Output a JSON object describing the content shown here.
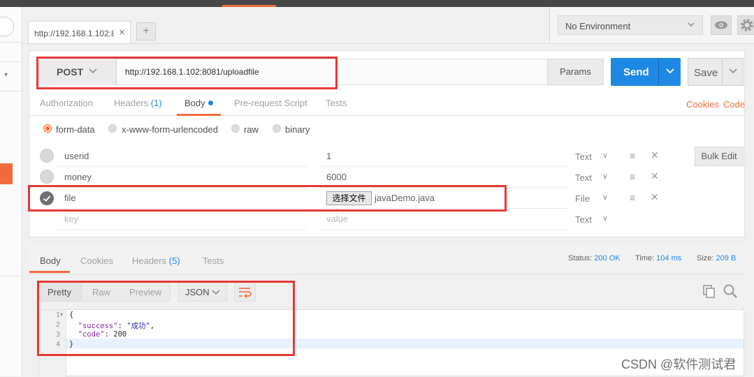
{
  "request_tab": {
    "label": "http://192.168.1.102:8",
    "close": "×",
    "new_tab": "+"
  },
  "environment": {
    "selected": "No Environment"
  },
  "request": {
    "method": "POST",
    "url": "http://192.168.1.102:8081/uploadfile",
    "params_label": "Params",
    "send_label": "Send",
    "save_label": "Save"
  },
  "request_tabs": {
    "authorization": "Authorization",
    "headers": "Headers",
    "headers_count": "(1)",
    "body": "Body",
    "prerequest": "Pre-request Script",
    "tests": "Tests",
    "cookies": "Cookies",
    "code": "Code"
  },
  "body_modes": [
    "form-data",
    "x-www-form-urlencoded",
    "raw",
    "binary"
  ],
  "form_rows": [
    {
      "key": "userid",
      "value": "1",
      "type": "Text"
    },
    {
      "key": "money",
      "value": "6000",
      "type": "Text"
    },
    {
      "key": "file",
      "file_button": "选择文件",
      "value": "javaDemo.java",
      "type": "File"
    }
  ],
  "form_placeholder": {
    "key": "key",
    "value": "value",
    "type": "Text"
  },
  "bulk_edit_label": "Bulk Edit",
  "response_tabs": {
    "body": "Body",
    "cookies": "Cookies",
    "headers": "Headers",
    "headers_count": "(5)",
    "tests": "Tests"
  },
  "response_status": {
    "status_label": "Status:",
    "status_value": "200 OK",
    "time_label": "Time:",
    "time_value": "104 ms",
    "size_label": "Size:",
    "size_value": "209 B"
  },
  "view_modes": [
    "Pretty",
    "Raw",
    "Preview"
  ],
  "format": "JSON",
  "code_lines": {
    "line_numbers": [
      "1",
      "2",
      "3",
      "4"
    ],
    "l1": "{",
    "l2_key": "\"success\"",
    "l2_value": "\"成功\"",
    "l3_key": "\"code\"",
    "l3_value": "200",
    "l4": "}"
  },
  "watermark": "CSDN @软件测试君",
  "colors": {
    "accent": "#f26b3a",
    "send": "#1e88e5",
    "highlight_box": "#e53935"
  }
}
